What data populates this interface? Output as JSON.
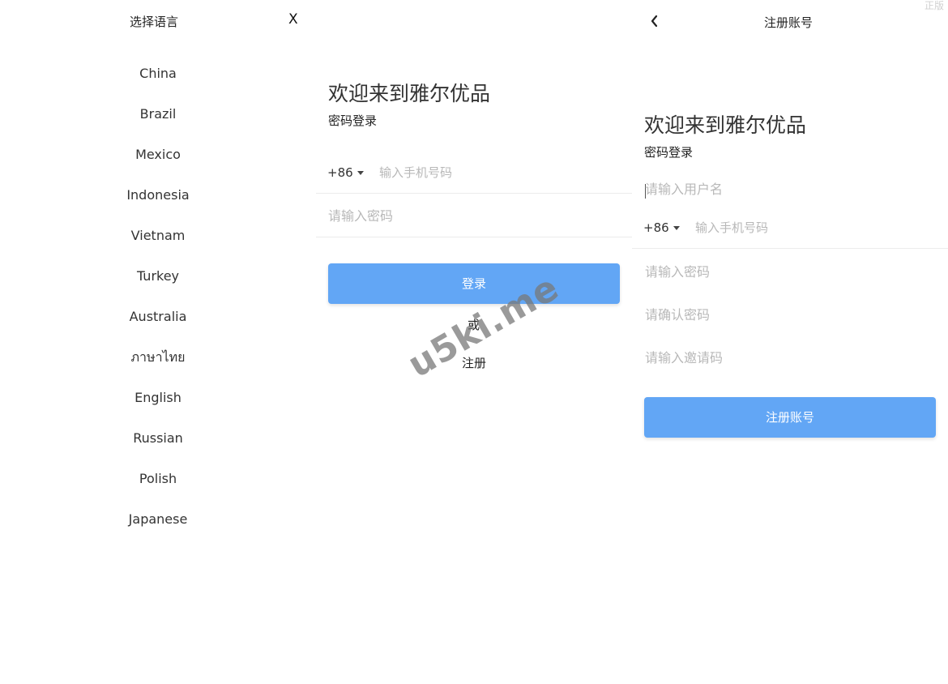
{
  "language_panel": {
    "title": "选择语言",
    "close_label": "X",
    "languages": [
      "China",
      "Brazil",
      "Mexico",
      "Indonesia",
      "Vietnam",
      "Turkey",
      "Australia",
      "ภาษาไทย",
      "English",
      "Russian",
      "Polish",
      "Japanese"
    ]
  },
  "login_panel": {
    "welcome": "欢迎来到雅尔优品",
    "subtitle": "密码登录",
    "country_code": "+86",
    "phone_placeholder": "输入手机号码",
    "password_placeholder": "请输入密码",
    "login_button": "登录",
    "or_text": "或",
    "register_link": "注册"
  },
  "register_panel": {
    "title": "注册账号",
    "back_icon": "chevron-left-icon",
    "welcome": "欢迎来到雅尔优品",
    "subtitle": "密码登录",
    "username_placeholder": "请输入用户名",
    "country_code": "+86",
    "phone_placeholder": "输入手机号码",
    "password_placeholder": "请输入密码",
    "confirm_password_placeholder": "请确认密码",
    "invite_code_placeholder": "请输入邀请码",
    "register_button": "注册账号"
  },
  "corner_text": "正版",
  "watermark": "u5ki.me",
  "colors": {
    "primary_button": "#62a6f5",
    "divider": "#ececec",
    "placeholder": "#b8b8b8"
  }
}
